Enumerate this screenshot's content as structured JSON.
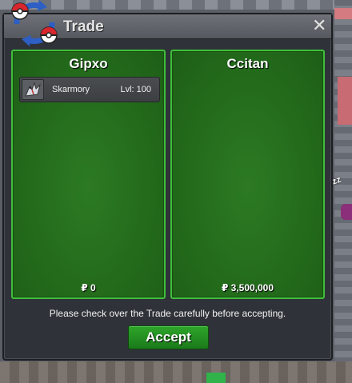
{
  "window": {
    "title": "Trade",
    "close_symbol": "✕",
    "close_icon": "close-icon",
    "logo_icon": "pokeball-swap-icon"
  },
  "left_panel": {
    "player": "Gipxo",
    "money": "₽ 0",
    "items": [
      {
        "name": "Skarmory",
        "level": "Lvl: 100",
        "icon": "skarmory-icon"
      }
    ]
  },
  "right_panel": {
    "player": "Ccitan",
    "money": "₽ 3,500,000",
    "items": []
  },
  "notice": "Please check over the Trade carefully before accepting.",
  "accept_label": "Accept",
  "colors": {
    "panel_green": "#236a1b",
    "panel_border": "#3fbf3a",
    "accept_green": "#2ea52a",
    "window_bg": "#2f3238"
  }
}
